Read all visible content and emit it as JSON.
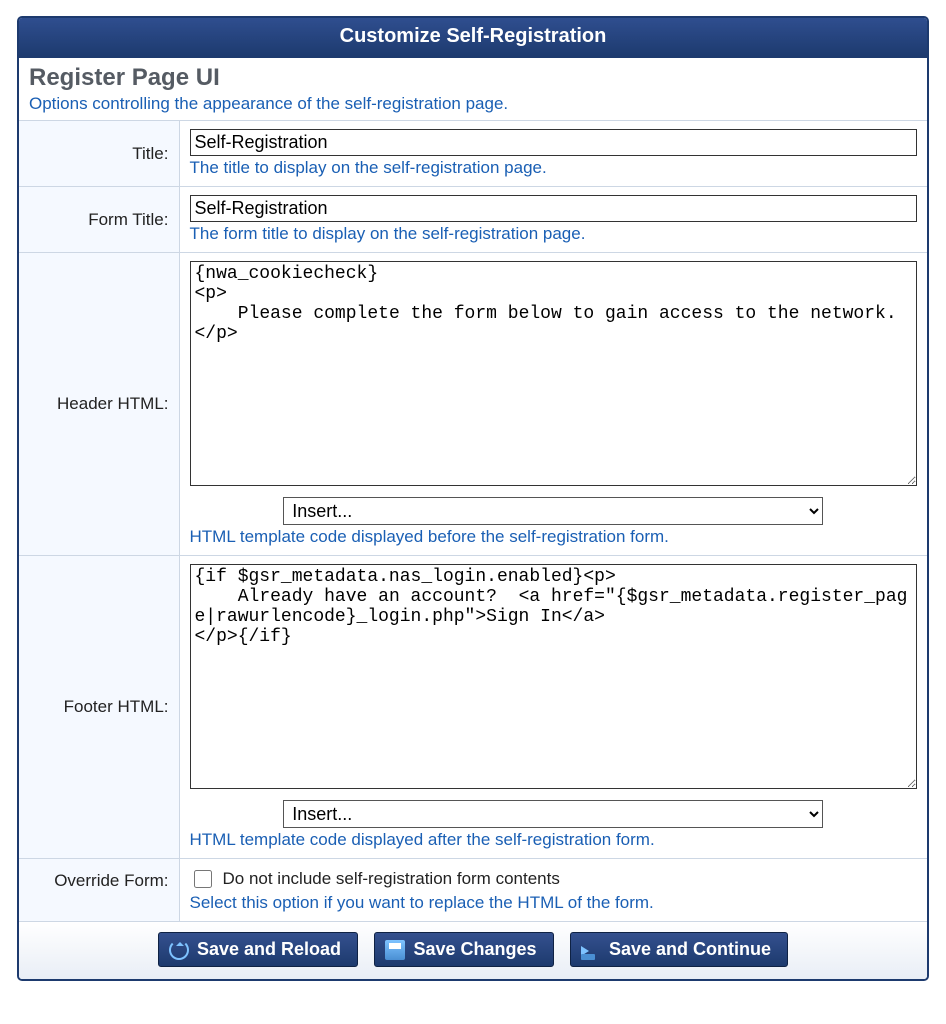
{
  "panelTitle": "Customize Self-Registration",
  "section": {
    "title": "Register Page UI",
    "subtitle": "Options controlling the appearance of the self-registration page."
  },
  "fields": {
    "title": {
      "label": "Title:",
      "value": "Self-Registration",
      "help": "The title to display on the self-registration page."
    },
    "formTitle": {
      "label": "Form Title:",
      "value": "Self-Registration",
      "help": "The form title to display on the self-registration page."
    },
    "headerHtml": {
      "label": "Header HTML:",
      "value": "{nwa_cookiecheck}\n<p>\n    Please complete the form below to gain access to the network.\n</p>",
      "insertPlaceholder": "Insert...",
      "help": "HTML template code displayed before the self-registration form."
    },
    "footerHtml": {
      "label": "Footer HTML:",
      "value": "{if $gsr_metadata.nas_login.enabled}<p>\n    Already have an account?  <a href=\"{$gsr_metadata.register_page|rawurlencode}_login.php\">Sign In</a>\n</p>{/if}",
      "insertPlaceholder": "Insert...",
      "help": "HTML template code displayed after the self-registration form."
    },
    "overrideForm": {
      "label": "Override Form:",
      "checkboxLabel": "Do not include self-registration form contents",
      "help": "Select this option if you want to replace the HTML of the form."
    }
  },
  "buttons": {
    "saveReload": "Save and Reload",
    "saveChanges": "Save Changes",
    "saveContinue": "Save and Continue"
  }
}
